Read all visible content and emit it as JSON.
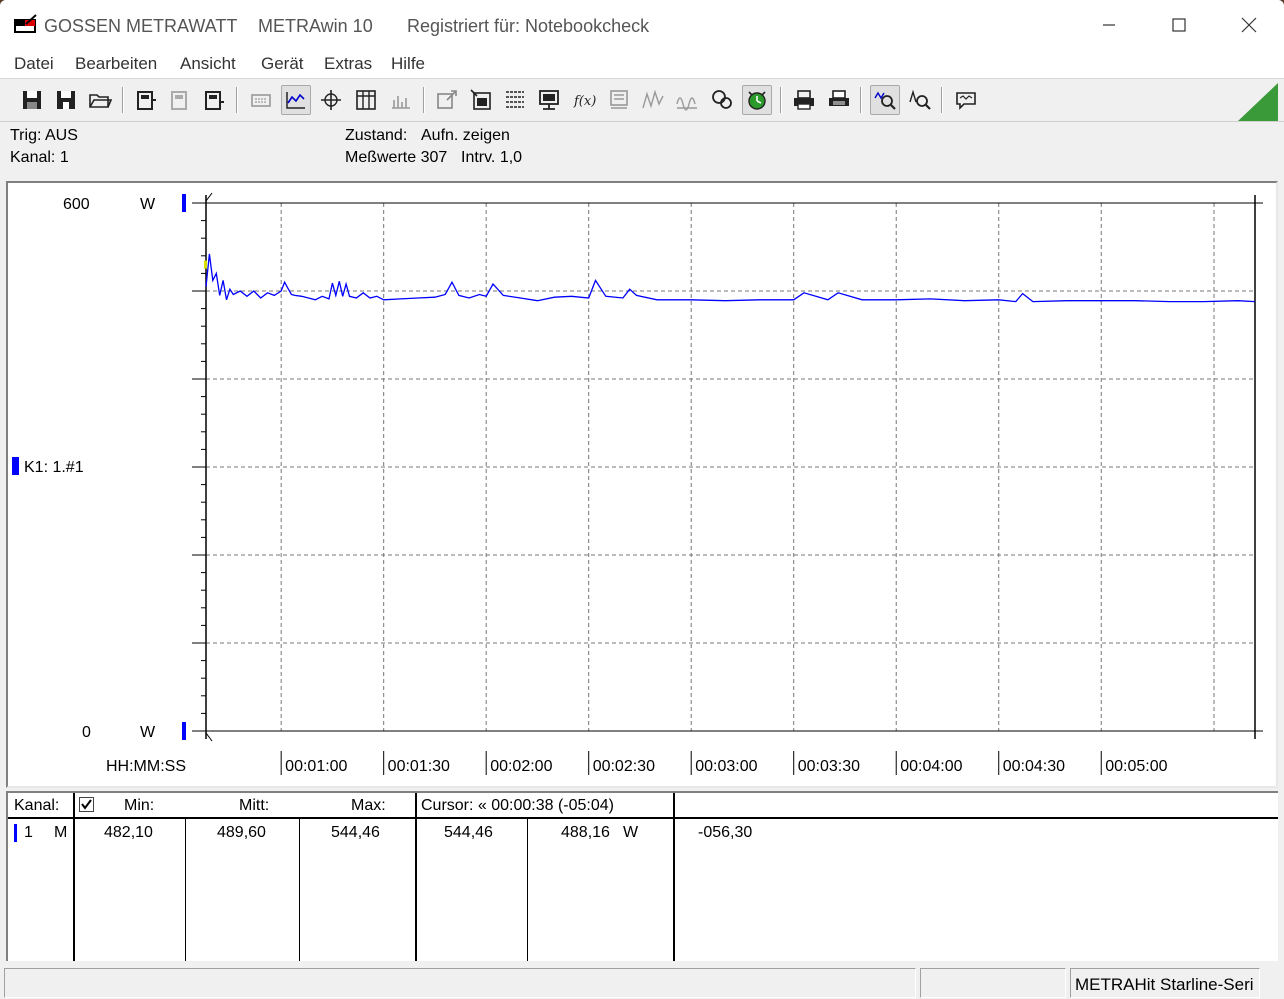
{
  "titlebar": {
    "brand": "GOSSEN METRAWATT",
    "app": "METRAwin 10",
    "registered": "Registriert für: Notebookcheck",
    "minimize_icon": "minimize-icon",
    "maximize_icon": "maximize-icon",
    "close_icon": "close-icon"
  },
  "menu": [
    "Datei",
    "Bearbeiten",
    "Ansicht",
    "Gerät",
    "Extras",
    "Hilfe"
  ],
  "status": {
    "trig": "Trig: AUS",
    "kanal": "Kanal: 1",
    "zustand_label": "Zustand:",
    "zustand_value": "Aufn. zeigen",
    "messwerte": "Meßwerte 307",
    "intervall": "Intrv. 1,0"
  },
  "chart_data": {
    "type": "line",
    "ylim": [
      0,
      600
    ],
    "y_top_label": "600",
    "y_bottom_label": "0",
    "y_unit": "W",
    "xlabel": "HH:MM:SS",
    "channel_label": "K1: 1.#1",
    "x_ticks": [
      "00:01:00",
      "00:01:30",
      "00:02:00",
      "00:02:30",
      "00:03:00",
      "00:03:30",
      "00:04:00",
      "00:04:30",
      "00:05:00"
    ],
    "x_tick_seconds": [
      60,
      90,
      120,
      150,
      180,
      210,
      240,
      270,
      300
    ],
    "xlim_seconds": [
      38,
      345
    ],
    "line_color": "#0000ff",
    "grid": true,
    "series": [
      {
        "x": [
          38,
          39,
          40,
          41,
          42,
          43,
          44,
          45,
          46,
          48,
          50,
          52,
          54,
          56,
          58,
          60,
          61,
          62,
          63,
          64,
          66,
          68,
          70,
          72,
          74,
          75,
          76,
          77,
          78,
          79,
          80,
          82,
          84,
          86,
          88,
          90,
          95,
          100,
          105,
          108,
          110,
          112,
          115,
          118,
          120,
          122,
          125,
          130,
          135,
          140,
          145,
          150,
          152,
          155,
          160,
          162,
          164,
          170,
          180,
          190,
          200,
          210,
          213,
          220,
          223,
          230,
          240,
          250,
          260,
          270,
          275,
          277,
          280,
          290,
          300,
          310,
          320,
          330,
          340,
          345
        ],
        "y": [
          505,
          542,
          512,
          520,
          495,
          512,
          490,
          502,
          496,
          500,
          494,
          500,
          492,
          498,
          495,
          500,
          510,
          503,
          496,
          495,
          494,
          492,
          490,
          494,
          491,
          509,
          495,
          511,
          494,
          508,
          494,
          492,
          498,
          492,
          494,
          490,
          491,
          492,
          493,
          496,
          510,
          495,
          492,
          496,
          494,
          508,
          495,
          492,
          489,
          493,
          494,
          492,
          512,
          494,
          492,
          502,
          495,
          490,
          490,
          489,
          490,
          490,
          498,
          490,
          498,
          490,
          490,
          491,
          489,
          490,
          488,
          497,
          488,
          489,
          489,
          489,
          488,
          488,
          489,
          488
        ]
      }
    ]
  },
  "table": {
    "headers": {
      "kanal": "Kanal:",
      "min": "Min:",
      "mitt": "Mitt:",
      "max": "Max:",
      "cursor": "Cursor: « 00:00:38 (-05:04)"
    },
    "row": {
      "channel": "1",
      "mode": "M",
      "min": "482,10",
      "mitt": "489,60",
      "max": "544,46",
      "cursor_value": "544,46",
      "cursor_value2": "488,16",
      "unit": "W",
      "delta": "-056,30"
    }
  },
  "statusbar": {
    "device": "METRAHit Starline-Seri"
  }
}
